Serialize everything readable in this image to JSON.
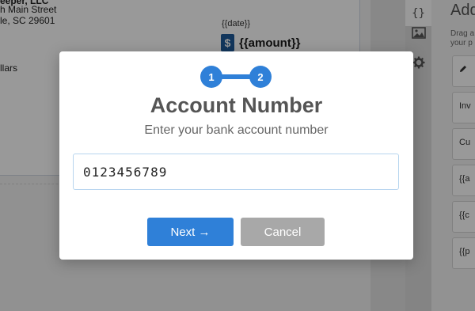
{
  "background": {
    "check": {
      "address_line_1": "eeper, LLC",
      "address_line_2": "h Main Street",
      "address_line_3": "le, SC 29601",
      "written_amount": "llars",
      "date_placeholder": "{{date}}",
      "amount_placeholder": "{{amount}}",
      "currency_symbol": "$"
    },
    "tool_tabs": {
      "variables_label": "{}",
      "image_icon": "image-icon",
      "settings_icon": "gear-icon"
    },
    "panel": {
      "title": "Add",
      "help_text_1": "Drag a",
      "help_text_2": "your p",
      "items": [
        "",
        "Inv",
        "Cu",
        "{{a",
        "{{c",
        "{{p"
      ]
    }
  },
  "modal": {
    "steps": [
      "1",
      "2"
    ],
    "title": "Account Number",
    "subtitle": "Enter your bank account number",
    "account_value": "0123456789",
    "next_label": "Next →",
    "cancel_label": "Cancel",
    "accent_color": "#2f80d8",
    "cancel_color": "#a8a8a8"
  }
}
